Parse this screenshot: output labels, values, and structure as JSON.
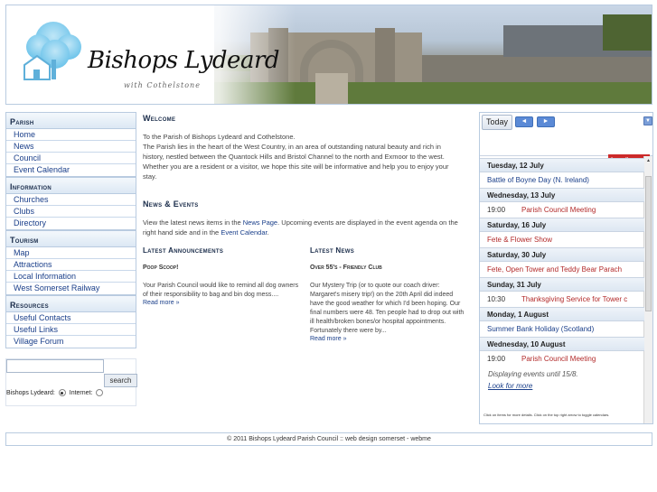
{
  "site": {
    "title": "Bishops Lydeard",
    "subtitle": "with Cothelstone"
  },
  "sidebar": {
    "sections": [
      {
        "heading": "Parish",
        "items": [
          "Home",
          "News",
          "Council",
          "Event Calendar"
        ]
      },
      {
        "heading": "Information",
        "items": [
          "Churches",
          "Clubs",
          "Directory"
        ]
      },
      {
        "heading": "Tourism",
        "items": [
          "Map",
          "Attractions",
          "Local Information",
          "West Somerset Railway"
        ]
      },
      {
        "heading": "Resources",
        "items": [
          "Useful Contacts",
          "Useful Links",
          "Village Forum"
        ]
      }
    ]
  },
  "search": {
    "button_label": "search",
    "scope_label": "Bishops Lydeard:",
    "scope_option_internet": "Internet:"
  },
  "main": {
    "welcome_title": "Welcome",
    "welcome_line1": "To the Parish of Bishops Lydeard and Cothelstone.",
    "welcome_line2": "The Parish lies in the heart of the West Country, in an area of outstanding natural beauty and rich in history, nestled between the Quantock Hills and Bristol Channel to the north and Exmoor to the west. Whether you are a resident or a visitor, we hope this site will be informative and help you to enjoy your stay.",
    "news_title": "News & Events",
    "news_text_pre": "View the latest news items in the ",
    "news_link": "News Page",
    "news_text_mid": ". Upcoming events are displayed in the event agenda on the right hand side and in the ",
    "calendar_link": "Event Calendar",
    "news_text_post": ".",
    "announcements": {
      "title": "Latest Announcements",
      "item_title": "Poop Scoop!",
      "item_text": "Your Parish Council would like to remind all dog owners of their responsibility to bag and bin dog mess....",
      "more": "Read more »"
    },
    "latest_news": {
      "title": "Latest News",
      "item_title": "Over 55's - Friendly Club",
      "item_text": "Our Mystery Trip (or to quote our coach driver: Margaret's misery trip!) on the 20th April did indeed have the good weather for which I'd been hoping. Our final numbers were 48. Ten people had to drop out with ill health/broken bones/or hospital appointments. Fortunately there were by...",
      "more": "Read more »"
    }
  },
  "calendar": {
    "today_label": "Today",
    "prev_icon": "◄",
    "next_icon": "►",
    "loading_label": "Loading...",
    "days": [
      {
        "date": "Tuesday, 12 July",
        "events": [
          {
            "time": "",
            "title": "Battle of Boyne Day (N. Ireland)",
            "color": "blue"
          }
        ]
      },
      {
        "date": "Wednesday, 13 July",
        "events": [
          {
            "time": "19:00",
            "title": "Parish Council Meeting",
            "color": "red"
          }
        ]
      },
      {
        "date": "Saturday, 16 July",
        "events": [
          {
            "time": "",
            "title": "Fete & Flower Show",
            "color": "red"
          }
        ]
      },
      {
        "date": "Saturday, 30 July",
        "events": [
          {
            "time": "",
            "title": "Fete, Open Tower and Teddy Bear Parach",
            "color": "red"
          }
        ]
      },
      {
        "date": "Sunday, 31 July",
        "events": [
          {
            "time": "10:30",
            "title": "Thanksgiving Service for Tower c",
            "color": "red"
          }
        ]
      },
      {
        "date": "Monday, 1 August",
        "events": [
          {
            "time": "",
            "title": "Summer Bank Holiday (Scotland)",
            "color": "blue"
          }
        ]
      },
      {
        "date": "Wednesday, 10 August",
        "events": [
          {
            "time": "19:00",
            "title": "Parish Council Meeting",
            "color": "red"
          }
        ]
      }
    ],
    "displaying_until": "Displaying events until 15/8.",
    "look_more": "Look for more",
    "hint": "Click on items for more details. Click on the top right arrow to toggle calendars."
  },
  "footer": {
    "text": "© 2011 Bishops Lydeard Parish Council :: web design somerset - webme"
  },
  "colors": {
    "link": "#1a3f8a",
    "event_red": "#b22a2a",
    "loading_bg": "#cc2a2a",
    "border": "#b9cbe0"
  }
}
